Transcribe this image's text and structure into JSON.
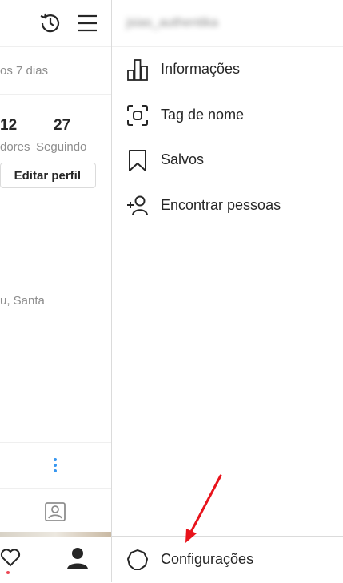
{
  "profile_panel": {
    "period_text": "os 7 dias",
    "followers_count": "12",
    "followers_label": "dores",
    "following_count": "27",
    "following_label": "Seguindo",
    "edit_profile_label": "Editar perfil",
    "bio_fragment": "u, Santa"
  },
  "drawer": {
    "username": "jsias_authentika",
    "items": [
      {
        "label": "Informações",
        "icon": "insights-icon"
      },
      {
        "label": "Tag de nome",
        "icon": "nametag-icon"
      },
      {
        "label": "Salvos",
        "icon": "bookmark-icon"
      },
      {
        "label": "Encontrar pessoas",
        "icon": "add-person-icon"
      }
    ],
    "settings_label": "Configurações"
  },
  "colors": {
    "text": "#262626",
    "muted": "#8e8e8e",
    "border": "#dbdbdb",
    "annotation_arrow": "#e8131b",
    "notification_dot": "#ed4956",
    "link_blue": "#3897f0"
  }
}
